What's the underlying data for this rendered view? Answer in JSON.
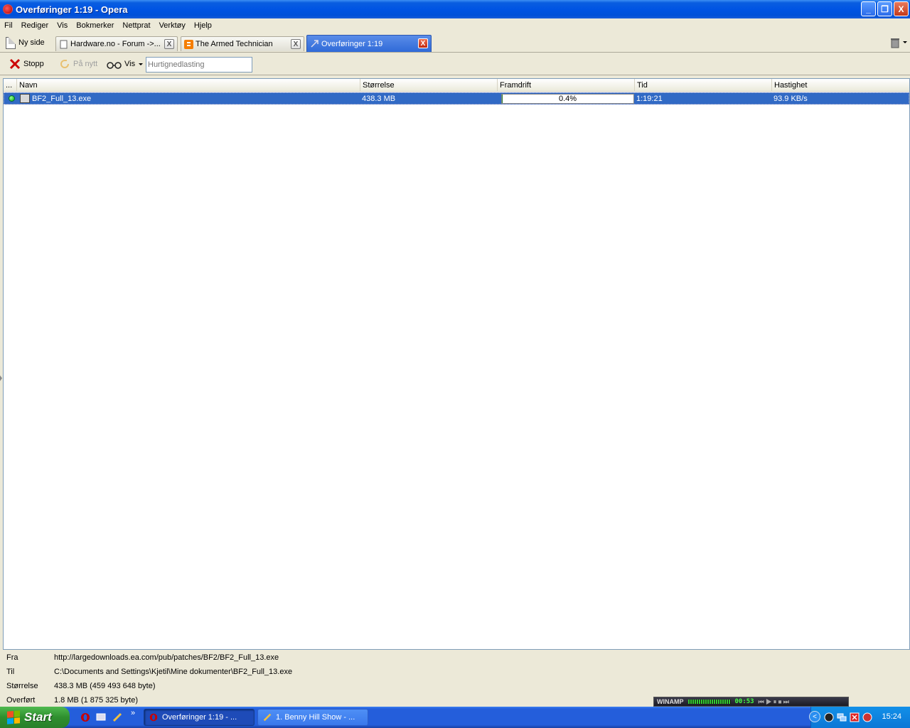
{
  "window": {
    "title": "Overføringer 1:19 - Opera",
    "minimize": "_",
    "restore": "❐",
    "close": "X"
  },
  "menu": [
    "Fil",
    "Rediger",
    "Vis",
    "Bokmerker",
    "Nettprat",
    "Verktøy",
    "Hjelp"
  ],
  "tabs": {
    "new_page_label": "Ny side",
    "items": [
      {
        "label": "Hardware.no - Forum ->..."
      },
      {
        "label": "The Armed Technician"
      },
      {
        "label": "Overføringer 1:19"
      }
    ],
    "close": "X"
  },
  "toolbar": {
    "stop_label": "Stopp",
    "retry_label": "På nytt",
    "view_label": "Vis",
    "quick_download_placeholder": "Hurtignedlasting"
  },
  "transfers": {
    "columns": [
      "...",
      "Navn",
      "Størrelse",
      "Framdrift",
      "Tid",
      "Hastighet"
    ],
    "rows": [
      {
        "name": "BF2_Full_13.exe",
        "size": "438.3 MB",
        "progress": "0.4%",
        "progress_value": 0.4,
        "time": "1:19:21",
        "speed": "93.9 KB/s"
      }
    ]
  },
  "details": {
    "from_label": "Fra",
    "from_value": "http://largedownloads.ea.com/pub/patches/BF2/BF2_Full_13.exe",
    "to_label": "Til",
    "to_value": "C:\\Documents and Settings\\Kjetil\\Mine dokumenter\\BF2_Full_13.exe",
    "size_label": "Størrelse",
    "size_value": "438.3 MB (459 493 648 byte)",
    "transferred_label": "Overført",
    "transferred_value": "1.8 MB (1 875 325 byte)"
  },
  "winamp": {
    "label": "WINAMP",
    "time": "00:53"
  },
  "taskbar": {
    "start_label": "Start",
    "chevron": "»",
    "tasks": [
      {
        "label": "Overføringer 1:19 - ..."
      },
      {
        "label": "1. Benny Hill Show - ..."
      }
    ],
    "tray_chevron": "<",
    "clock": "15:24"
  }
}
